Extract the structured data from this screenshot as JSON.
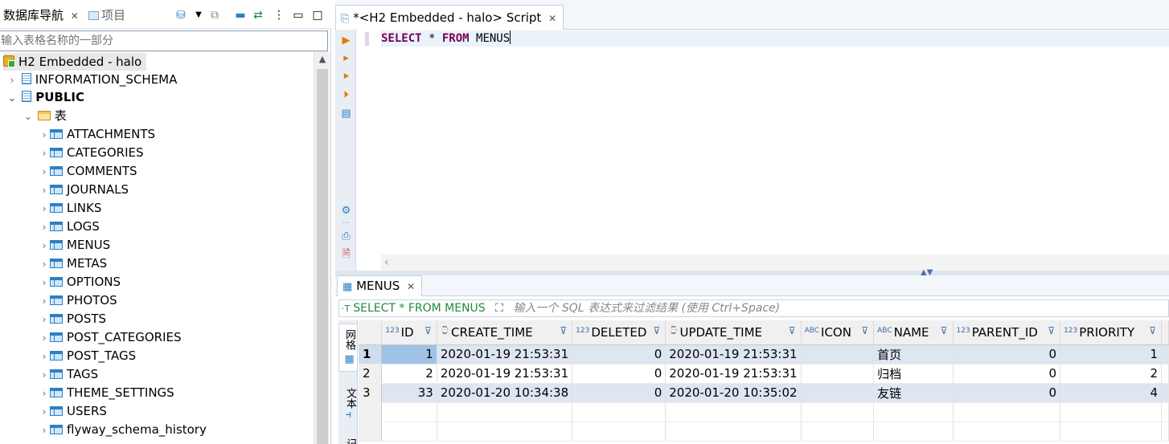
{
  "navigator": {
    "tab_label": "数据库导航",
    "project_tab_label": "项目",
    "filter_placeholder": "输入表格名称的一部分",
    "tree": {
      "connection": "H2 Embedded - halo",
      "schemas": [
        {
          "name": "INFORMATION_SCHEMA",
          "expanded": false
        },
        {
          "name": "PUBLIC",
          "expanded": true
        }
      ],
      "tables_folder": "表",
      "tables": [
        "ATTACHMENTS",
        "CATEGORIES",
        "COMMENTS",
        "JOURNALS",
        "LINKS",
        "LOGS",
        "MENUS",
        "METAS",
        "OPTIONS",
        "PHOTOS",
        "POSTS",
        "POST_CATEGORIES",
        "POST_TAGS",
        "TAGS",
        "THEME_SETTINGS",
        "USERS",
        "flyway_schema_history"
      ]
    }
  },
  "editor": {
    "tab_title": "*<H2 Embedded - halo> Script",
    "sql": {
      "kw1": "SELECT",
      "star": " * ",
      "kw2": "FROM",
      "table": " MENUS"
    }
  },
  "results": {
    "tab_title": "MENUS",
    "filter_query": "SELECT * FROM MENUS",
    "filter_placeholder": "输入一个 SQL 表达式来过滤结果 (使用 Ctrl+Space)",
    "side_tabs": [
      "网格",
      "文本",
      "记录"
    ],
    "columns": [
      {
        "type": "123",
        "name": "ID"
      },
      {
        "type": "⌚",
        "name": "CREATE_TIME"
      },
      {
        "type": "123",
        "name": "DELETED"
      },
      {
        "type": "⌚",
        "name": "UPDATE_TIME"
      },
      {
        "type": "ABC",
        "name": "ICON"
      },
      {
        "type": "ABC",
        "name": "NAME"
      },
      {
        "type": "123",
        "name": "PARENT_ID"
      },
      {
        "type": "123",
        "name": "PRIORITY"
      }
    ],
    "rows": [
      {
        "n": "1",
        "id": "1",
        "create_time": "2020-01-19 21:53:31",
        "deleted": "0",
        "update_time": "2020-01-19 21:53:31",
        "icon": "",
        "name": "首页",
        "parent_id": "0",
        "priority": "1"
      },
      {
        "n": "2",
        "id": "2",
        "create_time": "2020-01-19 21:53:31",
        "deleted": "0",
        "update_time": "2020-01-19 21:53:31",
        "icon": "",
        "name": "归档",
        "parent_id": "0",
        "priority": "2"
      },
      {
        "n": "3",
        "id": "33",
        "create_time": "2020-01-20 10:34:38",
        "deleted": "0",
        "update_time": "2020-01-20 10:35:02",
        "icon": "",
        "name": "友链",
        "parent_id": "0",
        "priority": "4"
      }
    ]
  },
  "colors": {
    "accent": "#2e7fc4",
    "keyword": "#7a0050",
    "selection": "#9fc2e6",
    "alt_row": "#dde6f1"
  }
}
